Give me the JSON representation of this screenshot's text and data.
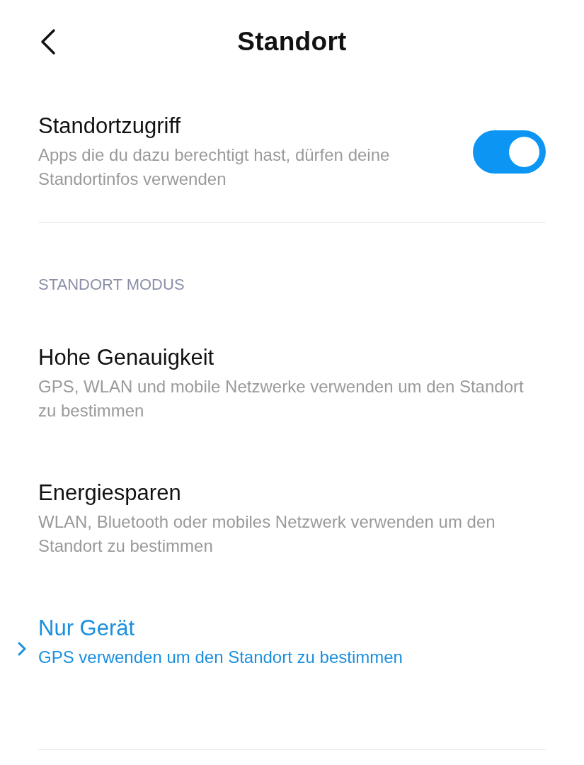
{
  "header": {
    "title": "Standort"
  },
  "location_access": {
    "title": "Standortzugriff",
    "description": "Apps die du dazu berechtigt hast, dürfen deine Standortinfos verwenden",
    "on": true
  },
  "mode_section": {
    "heading": "STANDORT MODUS",
    "modes": [
      {
        "title": "Hohe Genauigkeit",
        "description": "GPS, WLAN und mobile Netzwerke verwenden um den Standort zu bestimmen",
        "selected": false
      },
      {
        "title": "Energiesparen",
        "description": "WLAN, Bluetooth oder mobiles Netzwerk verwenden um den Standort zu bestimmen",
        "selected": false
      },
      {
        "title": "Nur Gerät",
        "description": "GPS verwenden um den Standort zu bestimmen",
        "selected": true
      }
    ]
  }
}
